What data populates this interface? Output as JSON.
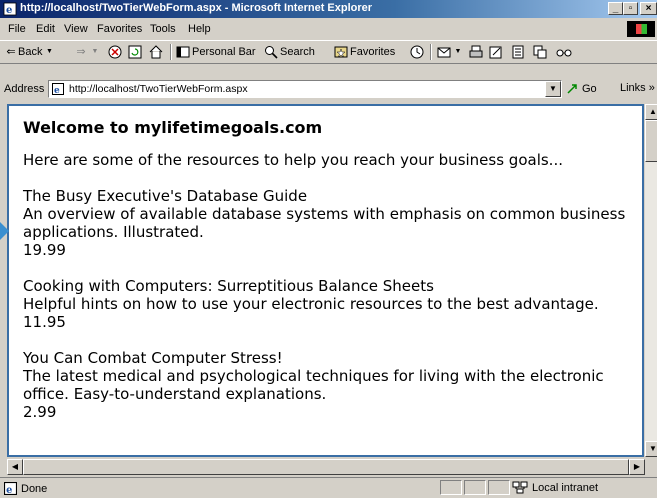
{
  "window": {
    "title": "http://localhost/TwoTierWebForm.aspx - Microsoft Internet Explorer",
    "min_glyph": "_",
    "max_glyph": "▫",
    "close_glyph": "×"
  },
  "menu": [
    "File",
    "Edit",
    "View",
    "Favorites",
    "Tools",
    "Help"
  ],
  "toolbar": {
    "back": "Back",
    "personal_bar": "Personal Bar",
    "search": "Search",
    "favorites": "Favorites"
  },
  "address": {
    "label": "Address",
    "url": "http://localhost/TwoTierWebForm.aspx",
    "go": "Go",
    "links": "Links »"
  },
  "page": {
    "heading": "Welcome to mylifetimegoals.com",
    "intro": "Here are some of the resources to help you reach your business goals...",
    "books": [
      {
        "title": "The Busy Executive's Database Guide",
        "description": "An overview of available database systems with emphasis on common business applications. Illustrated.",
        "price": "19.99"
      },
      {
        "title": "Cooking with Computers: Surreptitious Balance Sheets",
        "description": "Helpful hints on how to use your electronic resources to the best advantage.",
        "price": "11.95"
      },
      {
        "title": "You Can Combat Computer Stress!",
        "description": "The latest medical and psychological techniques for living with the electronic office. Easy-to-understand explanations.",
        "price": "2.99"
      }
    ]
  },
  "status": {
    "text": "Done",
    "zone": "Local intranet"
  },
  "colors": {
    "titlebar": "#0a246a",
    "content_border": "#3a6ea5",
    "chrome": "#d4d0c8"
  }
}
